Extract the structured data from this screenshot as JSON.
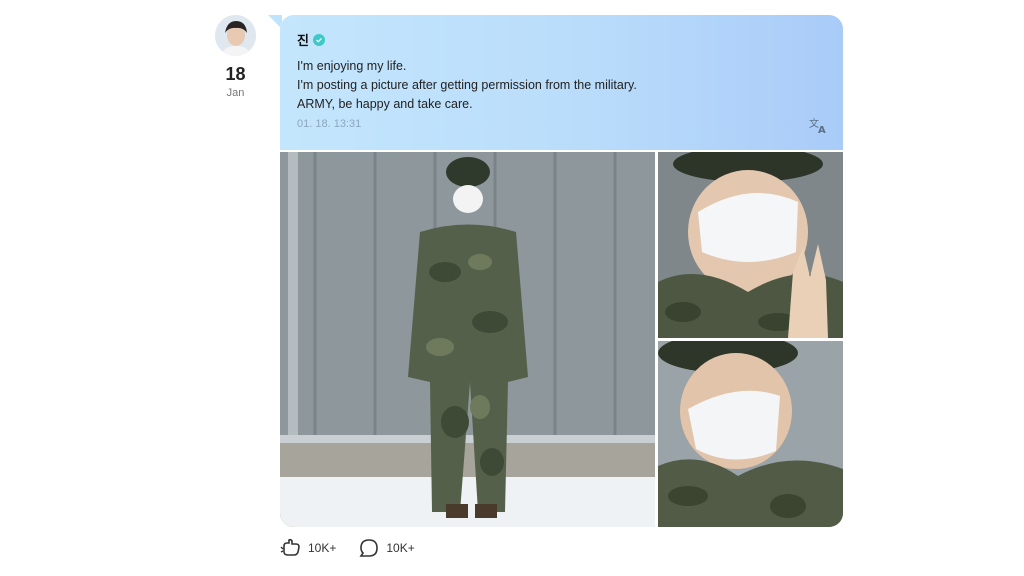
{
  "post": {
    "avatar_icon": "avatar-icon",
    "date_day": "18",
    "date_month": "Jan",
    "author": "진",
    "verified_icon": "verified-badge-icon",
    "lines": [
      "I'm enjoying my life.",
      "I'm posting a picture after getting permission from the military.",
      "ARMY, be happy and take care."
    ],
    "timestamp": "01. 18. 13:31",
    "translate_icon": "translate-icon",
    "bubble_color_start": "#c4e6fc",
    "bubble_color_end": "#a9cbf8",
    "verified_color": "#3cc9c7"
  },
  "actions": {
    "like_icon": "cheer-icon",
    "like_count": "10K+",
    "comment_icon": "comment-icon",
    "comment_count": "10K+"
  }
}
